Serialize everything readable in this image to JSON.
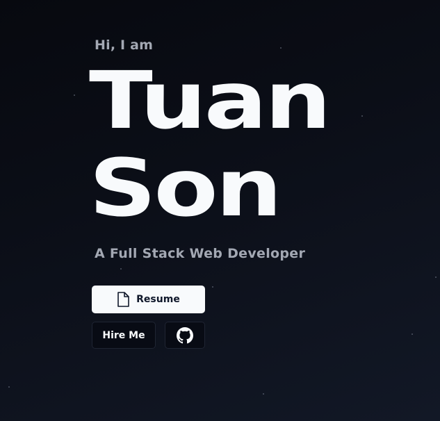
{
  "hero": {
    "greeting": "Hi, I am",
    "name_line_1": "Tuan",
    "name_line_2": "Son",
    "subtitle": "A Full Stack Web Developer"
  },
  "actions": {
    "resume_label": "Resume",
    "resume_icon": "document-icon",
    "hire_label": "Hire Me",
    "github_icon": "github-icon"
  },
  "colors": {
    "background": "#0b0e17",
    "heading": "#f8fafc",
    "muted": "#a3a8b3",
    "button_light": "#f8fafc",
    "button_dark": "#080b14"
  }
}
